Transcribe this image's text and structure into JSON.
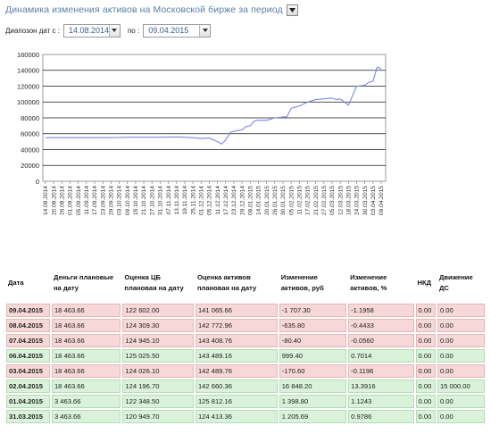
{
  "header": {
    "title": "Динамика изменения активов на Московской бирже за период",
    "dropdown_icon": "chevron-down-icon"
  },
  "range": {
    "label": "Диапозон дат с :",
    "from": "14.08.2014",
    "to_label": "по :",
    "to": "09.04.2015"
  },
  "chart_data": {
    "type": "line",
    "title": "",
    "xlabel": "",
    "ylabel": "",
    "ylim": [
      0,
      160000
    ],
    "yticks": [
      0,
      20000,
      40000,
      60000,
      80000,
      100000,
      120000,
      140000,
      160000
    ],
    "x_tick_labels": [
      "14.08.2014",
      "20.08.2014",
      "26.08.2014",
      "01.09.2014",
      "05.09.2014",
      "11.09.2014",
      "17.09.2014",
      "23.09.2014",
      "29.09.2014",
      "03.10.2014",
      "09.10.2014",
      "15.10.2014",
      "21.10.2014",
      "27.10.2014",
      "31.10.2014",
      "07.11.2014",
      "13.11.2014",
      "19.11.2014",
      "25.11.2014",
      "01.12.2014",
      "05.12.2014",
      "11.12.2014",
      "17.12.2014",
      "23.12.2014",
      "29.12.2014",
      "08.01.2015",
      "14.01.2015",
      "20.01.2015",
      "26.01.2015",
      "30.01.2015",
      "05.02.2015",
      "11.02.2015",
      "17.02.2015",
      "21.02.2015",
      "27.02.2015",
      "05.03.2015",
      "12.03.2015",
      "18.03.2015",
      "24.03.2015",
      "30.03.2015",
      "03.04.2015",
      "09.04.2015"
    ],
    "grid": true,
    "legend": "none",
    "line_color": "#7b87e6",
    "series": [
      {
        "x": [
          0,
          2,
          4,
          6,
          8,
          10,
          12,
          14,
          16,
          18,
          19,
          20,
          21,
          21.5,
          22,
          22.3,
          22.6,
          23,
          23.5,
          24,
          24.5,
          25,
          25.5,
          26,
          27,
          28,
          29,
          29.5,
          30,
          31,
          32,
          33,
          34,
          35,
          35.5,
          36,
          36.5,
          37,
          38,
          39,
          39.5,
          40,
          40.5,
          41
        ],
        "values": [
          55000,
          55000,
          55000,
          55000,
          55000,
          55500,
          55500,
          55500,
          56000,
          55000,
          54000,
          54500,
          50000,
          47000,
          52000,
          57000,
          62000,
          63000,
          64000,
          65000,
          69000,
          70000,
          76000,
          77000,
          77000,
          80000,
          81000,
          81500,
          92000,
          95000,
          100000,
          103000,
          104000,
          105000,
          103000,
          104000,
          100000,
          96000,
          120000,
          121000,
          125000,
          126000,
          144000,
          142000
        ]
      }
    ]
  },
  "table": {
    "headers": [
      "Дата",
      "Деньги плановые на дату",
      "Оценка ЦБ плановая на дату",
      "Оценка активов плановая на дату",
      "Изменение активов, руб",
      "Изменение активов, %",
      "НКД",
      "Движение ДС"
    ],
    "rows": [
      {
        "status": "neg",
        "cells": [
          "09.04.2015",
          "18 463.66",
          "122 602.00",
          "141 065.66",
          "-1 707.30",
          "-1.1958",
          "0.00",
          "0.00"
        ]
      },
      {
        "status": "neg",
        "cells": [
          "08.04.2015",
          "18 463.66",
          "124 309.30",
          "142 772.96",
          "-635.80",
          "-0.4433",
          "0.00",
          "0.00"
        ]
      },
      {
        "status": "neg",
        "cells": [
          "07.04.2015",
          "18 463.66",
          "124 945.10",
          "143 408.76",
          "-80.40",
          "-0.0560",
          "0.00",
          "0.00"
        ]
      },
      {
        "status": "pos",
        "cells": [
          "06.04.2015",
          "18 463.66",
          "125 025.50",
          "143 489.16",
          "999.40",
          "0.7014",
          "0.00",
          "0.00"
        ]
      },
      {
        "status": "neg",
        "cells": [
          "03.04.2015",
          "18 463.66",
          "124 026.10",
          "142 489.76",
          "-170.60",
          "-0.1196",
          "0.00",
          "0.00"
        ]
      },
      {
        "status": "pos",
        "cells": [
          "02.04.2015",
          "18 463.66",
          "124 196.70",
          "142 660.36",
          "16 848.20",
          "13.3916",
          "0.00",
          "15 000.00"
        ]
      },
      {
        "status": "pos",
        "cells": [
          "01.04.2015",
          "3 463.66",
          "122 348.50",
          "125 812.16",
          "1 398.80",
          "1.1243",
          "0.00",
          "0.00"
        ]
      },
      {
        "status": "pos",
        "cells": [
          "31.03.2015",
          "3 463.66",
          "120 949.70",
          "124 413.36",
          "1 205.69",
          "0.9786",
          "0.00",
          "0.00"
        ]
      }
    ]
  }
}
